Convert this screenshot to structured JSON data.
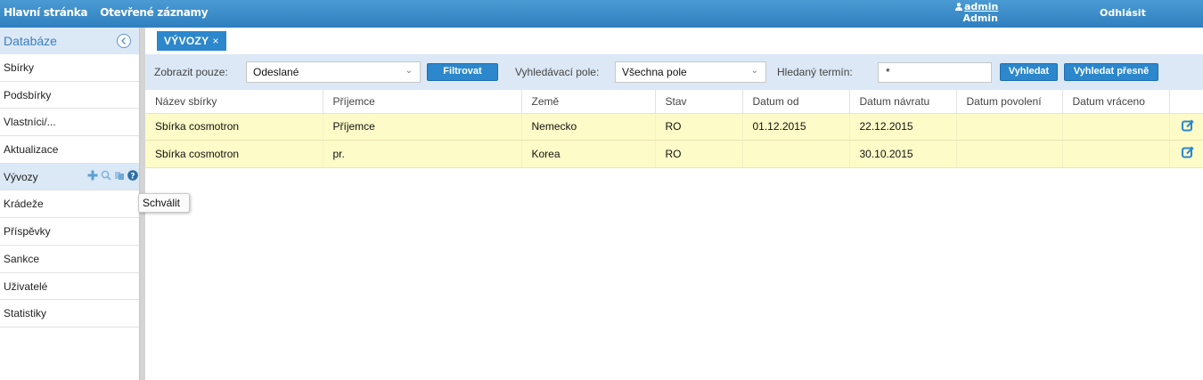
{
  "topbar": {
    "nav": [
      "Hlavní stránka",
      "Otevřené záznamy"
    ],
    "user_name": "admin",
    "user_role": "Admin",
    "logout": "Odhlásit"
  },
  "sidebar": {
    "title": "Databáze",
    "items": [
      {
        "label": "Sbírky"
      },
      {
        "label": "Podsbírky"
      },
      {
        "label": "Vlastníci/..."
      },
      {
        "label": "Aktualizace"
      },
      {
        "label": "Vývozy",
        "active": true
      },
      {
        "label": "Krádeže"
      },
      {
        "label": "Příspěvky"
      },
      {
        "label": "Sankce"
      },
      {
        "label": "Uživatelé"
      },
      {
        "label": "Statistiky"
      }
    ],
    "tooltip": "Schválit"
  },
  "tab": {
    "label": "VÝVOZY",
    "close": "×"
  },
  "filter": {
    "show_only_label": "Zobrazit pouze:",
    "show_only_value": "Odeslané",
    "filter_button": "Filtrovat",
    "search_field_label": "Vyhledávací pole:",
    "search_field_value": "Všechna pole",
    "term_label": "Hledaný termín:",
    "term_value": "*",
    "search_button": "Vyhledat",
    "search_exact_button": "Vyhledat přesně"
  },
  "table": {
    "columns": [
      "Název sbírky",
      "Příjemce",
      "Země",
      "Stav",
      "Datum od",
      "Datum návratu",
      "Datum povolení",
      "Datum vráceno",
      ""
    ],
    "rows": [
      [
        "Sbírka cosmotron",
        "Příjemce",
        "Nemecko",
        "RO",
        "01.12.2015",
        "22.12.2015",
        "",
        ""
      ],
      [
        "Sbírka cosmotron",
        "pr.",
        "Korea",
        "RO",
        "",
        "30.10.2015",
        "",
        ""
      ]
    ]
  },
  "colors": {
    "accent": "#2c87cc",
    "row_bg": "#fdfbc7",
    "filter_bg": "#dce8f5"
  }
}
